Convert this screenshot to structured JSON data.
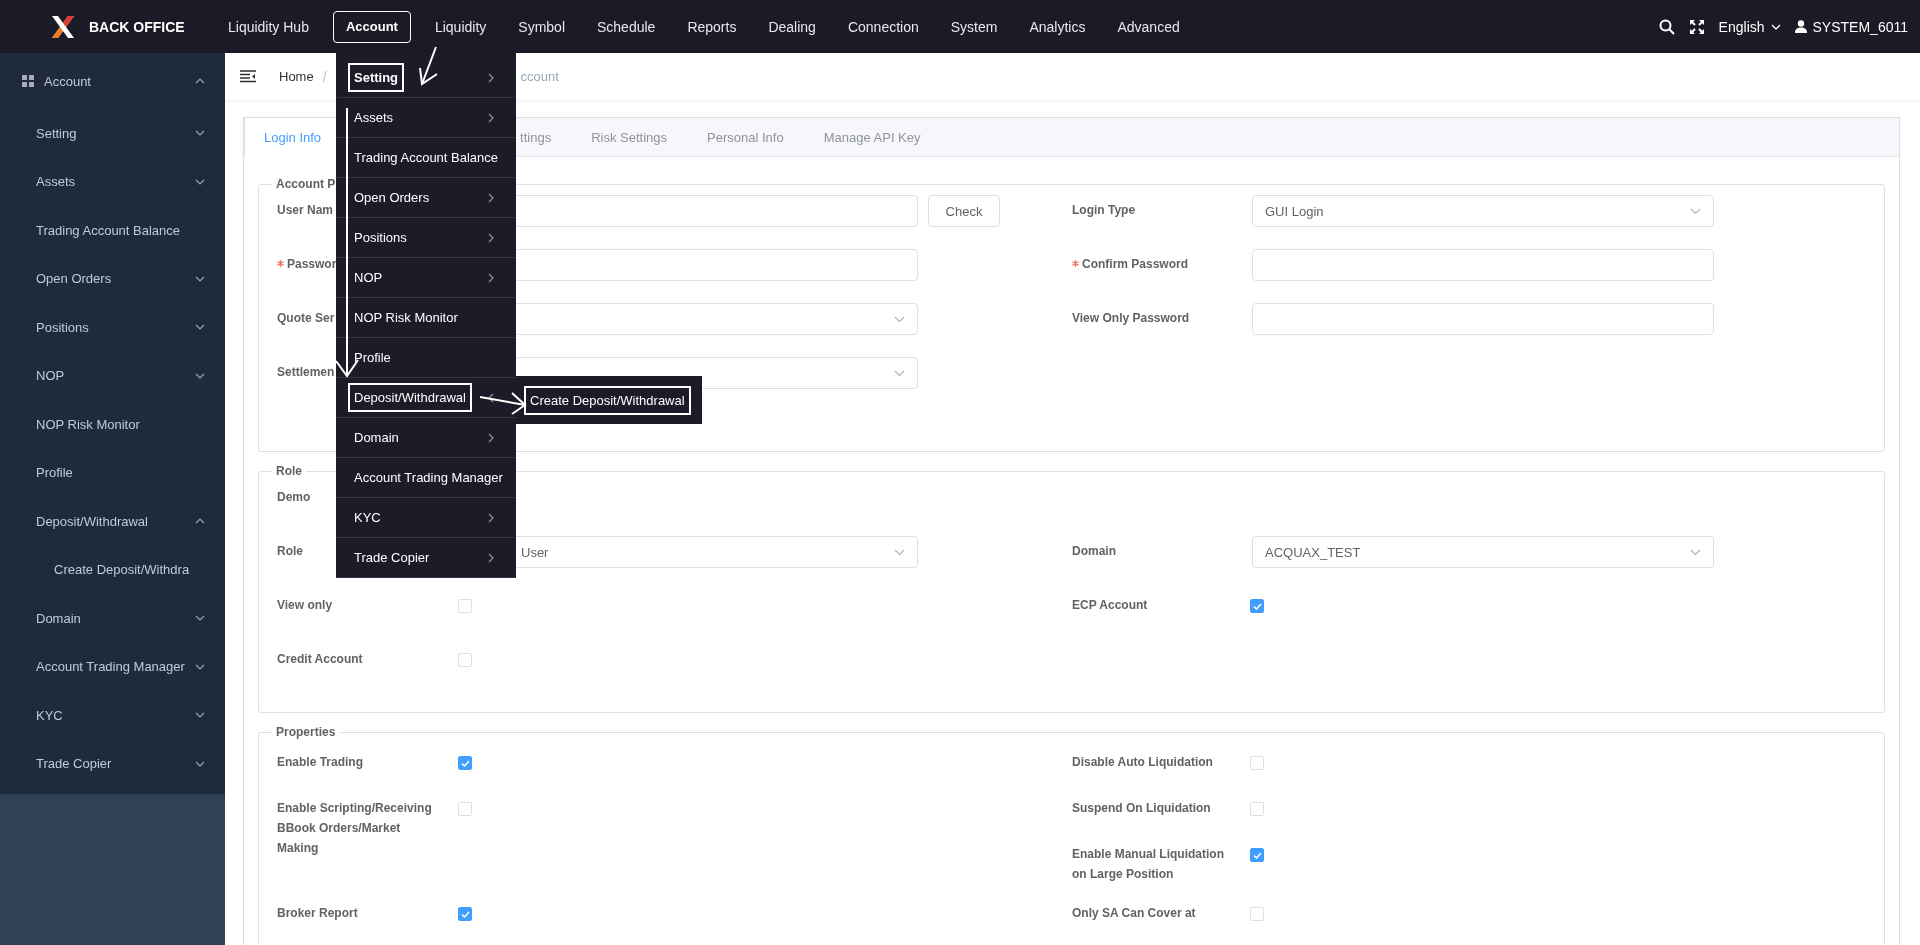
{
  "header": {
    "logo_text": "BACK OFFICE",
    "nav": [
      {
        "label": "Liquidity Hub",
        "selected": false,
        "highlighted": false
      },
      {
        "label": "Account",
        "selected": true,
        "highlighted": true
      },
      {
        "label": "Liquidity",
        "selected": false,
        "highlighted": false
      },
      {
        "label": "Symbol",
        "selected": false,
        "highlighted": false
      },
      {
        "label": "Schedule",
        "selected": false,
        "highlighted": false
      },
      {
        "label": "Reports",
        "selected": false,
        "highlighted": false
      },
      {
        "label": "Dealing",
        "selected": false,
        "highlighted": false
      },
      {
        "label": "Connection",
        "selected": false,
        "highlighted": false
      },
      {
        "label": "System",
        "selected": false,
        "highlighted": false
      },
      {
        "label": "Analytics",
        "selected": false,
        "highlighted": false
      },
      {
        "label": "Advanced",
        "selected": false,
        "highlighted": false
      }
    ],
    "language": "English",
    "user": "SYSTEM_6011"
  },
  "sidebar": {
    "items": [
      {
        "label": "Account",
        "expanded": true,
        "children": [
          {
            "label": "Setting",
            "expanded": false
          },
          {
            "label": "Assets",
            "expanded": false
          },
          {
            "label": "Trading Account Balance"
          },
          {
            "label": "Open Orders",
            "expanded": false
          },
          {
            "label": "Positions",
            "expanded": false
          },
          {
            "label": "NOP",
            "expanded": false
          },
          {
            "label": "NOP Risk Monitor"
          },
          {
            "label": "Profile"
          },
          {
            "label": "Deposit/Withdrawal",
            "expanded": true,
            "children": [
              {
                "label": "Create Deposit/Withdra"
              }
            ]
          },
          {
            "label": "Domain",
            "expanded": false
          },
          {
            "label": "Account Trading Manager",
            "expanded": false
          },
          {
            "label": "KYC",
            "expanded": false
          },
          {
            "label": "Trade Copier",
            "expanded": false
          }
        ]
      }
    ]
  },
  "breadcrumb": {
    "separator": "/",
    "items": [
      {
        "label": "Home"
      },
      {
        "label": "ccount"
      }
    ]
  },
  "tabs": [
    {
      "label": "Login Info",
      "selected": true
    },
    {
      "label": "ttings",
      "selected": false
    },
    {
      "label": "Risk Settings",
      "selected": false
    },
    {
      "label": "Personal Info",
      "selected": false
    },
    {
      "label": "Manage API Key",
      "selected": false
    }
  ],
  "sections": [
    {
      "legend": "Account P",
      "rows": [
        {
          "left": {
            "label": "User Nam",
            "kind": "input",
            "button": "Check"
          },
          "right": {
            "label": "Login Type",
            "kind": "select",
            "value": "GUI Login"
          }
        },
        {
          "left": {
            "label": "Passwor",
            "kind": "input",
            "required": true
          },
          "right": {
            "label": "Confirm Password",
            "kind": "input",
            "required": true
          }
        },
        {
          "left": {
            "label": "Quote Ser",
            "kind": "select"
          },
          "right": {
            "label": "View Only Password",
            "kind": "input"
          }
        },
        {
          "left": {
            "label": "Settlemen",
            "kind": "select"
          },
          "right": null
        }
      ]
    },
    {
      "legend": "Role",
      "rows": [
        {
          "left": {
            "label": "Demo"
          },
          "right": null
        },
        {
          "left": {
            "label": "Role",
            "kind": "select",
            "value": "User"
          },
          "right": {
            "label": "Domain",
            "kind": "select",
            "value": "ACQUAX_TEST"
          }
        },
        {
          "left": {
            "label": "View only",
            "kind": "checkbox",
            "checked": false
          },
          "right": {
            "label": "ECP Account",
            "kind": "checkbox",
            "checked": true
          }
        },
        {
          "left": {
            "label": "Credit Account",
            "kind": "checkbox",
            "checked": false
          },
          "right": null
        }
      ]
    },
    {
      "legend": "Properties",
      "rows": [
        {
          "left": {
            "label": "Enable Trading",
            "kind": "checkbox",
            "checked": true
          },
          "right": {
            "label": "Disable Auto Liquidation",
            "kind": "checkbox",
            "checked": false
          }
        },
        {
          "left": {
            "label": "Enable Scripting/Receiving BBook Orders/Market Making",
            "kind": "checkbox",
            "checked": false
          },
          "right": {
            "label": "Suspend On Liquidation",
            "kind": "checkbox",
            "checked": false
          }
        },
        {
          "left": null,
          "right": {
            "label": "Enable Manual Liquidation on Large Position",
            "kind": "checkbox",
            "checked": true
          }
        },
        {
          "left": {
            "label": "Broker Report",
            "kind": "checkbox",
            "checked": true
          },
          "right": {
            "label": "Only SA Can Cover at",
            "kind": "checkbox",
            "checked": false
          }
        }
      ]
    }
  ],
  "account_menu": {
    "items": [
      {
        "label": "Setting",
        "submenu": true,
        "selected": true,
        "highlighted": true
      },
      {
        "label": "Assets",
        "submenu": true,
        "selected": false,
        "highlighted": false
      },
      {
        "label": "Trading Account Balance",
        "submenu": false,
        "selected": false,
        "highlighted": false
      },
      {
        "label": "Open Orders",
        "submenu": true,
        "selected": false,
        "highlighted": false
      },
      {
        "label": "Positions",
        "submenu": true,
        "selected": false,
        "highlighted": false
      },
      {
        "label": "NOP",
        "submenu": true,
        "selected": false,
        "highlighted": false
      },
      {
        "label": "NOP Risk Monitor",
        "submenu": false,
        "selected": false,
        "highlighted": false
      },
      {
        "label": "Profile",
        "submenu": false,
        "selected": false,
        "highlighted": false
      },
      {
        "label": "Deposit/Withdrawal",
        "submenu": true,
        "selected": false,
        "highlighted": true,
        "expanded": true,
        "children": [
          {
            "label": "Create Deposit/Withdrawal",
            "highlighted": true
          }
        ]
      },
      {
        "label": "Domain",
        "submenu": true,
        "selected": false,
        "highlighted": false
      },
      {
        "label": "Account Trading Manager",
        "submenu": false,
        "selected": false,
        "highlighted": false
      },
      {
        "label": "KYC",
        "submenu": true,
        "selected": false,
        "highlighted": false
      },
      {
        "label": "Trade Copier",
        "submenu": true,
        "selected": false,
        "highlighted": false
      }
    ]
  }
}
